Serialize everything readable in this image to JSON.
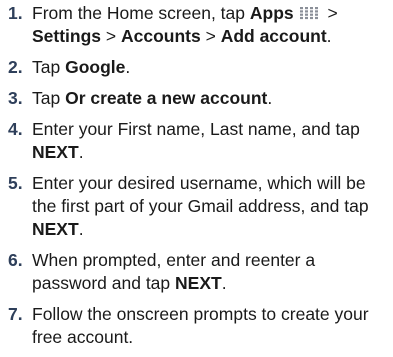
{
  "steps": [
    {
      "number": "1.",
      "parts": {
        "t1": "From the Home screen, tap ",
        "apps": "Apps",
        "gt1": " > ",
        "settings": "Settings",
        "gt2": " > ",
        "accounts": "Accounts",
        "gt3": " > ",
        "add_account": "Add account",
        "end": "."
      },
      "icon": "apps-grid-icon"
    },
    {
      "number": "2.",
      "parts": {
        "t1": "Tap ",
        "b1": "Google",
        "end": "."
      }
    },
    {
      "number": "3.",
      "parts": {
        "t1": "Tap ",
        "b1": "Or create a new account",
        "end": "."
      }
    },
    {
      "number": "4.",
      "parts": {
        "t1": "Enter your First name, Last name, and tap ",
        "b1": "NEXT",
        "end": "."
      }
    },
    {
      "number": "5.",
      "parts": {
        "t1": "Enter your desired username, which will be the first part of your Gmail address, and tap ",
        "b1": "NEXT",
        "end": "."
      }
    },
    {
      "number": "6.",
      "parts": {
        "t1": "When prompted, enter and reenter a password and tap ",
        "b1": "NEXT",
        "end": "."
      }
    },
    {
      "number": "7.",
      "parts": {
        "t1": "Follow the onscreen prompts to create your free account."
      }
    }
  ],
  "colors": {
    "text": "#1a1a1a",
    "number": "#2e3f5a",
    "icon_dots": "#8a8f98"
  }
}
